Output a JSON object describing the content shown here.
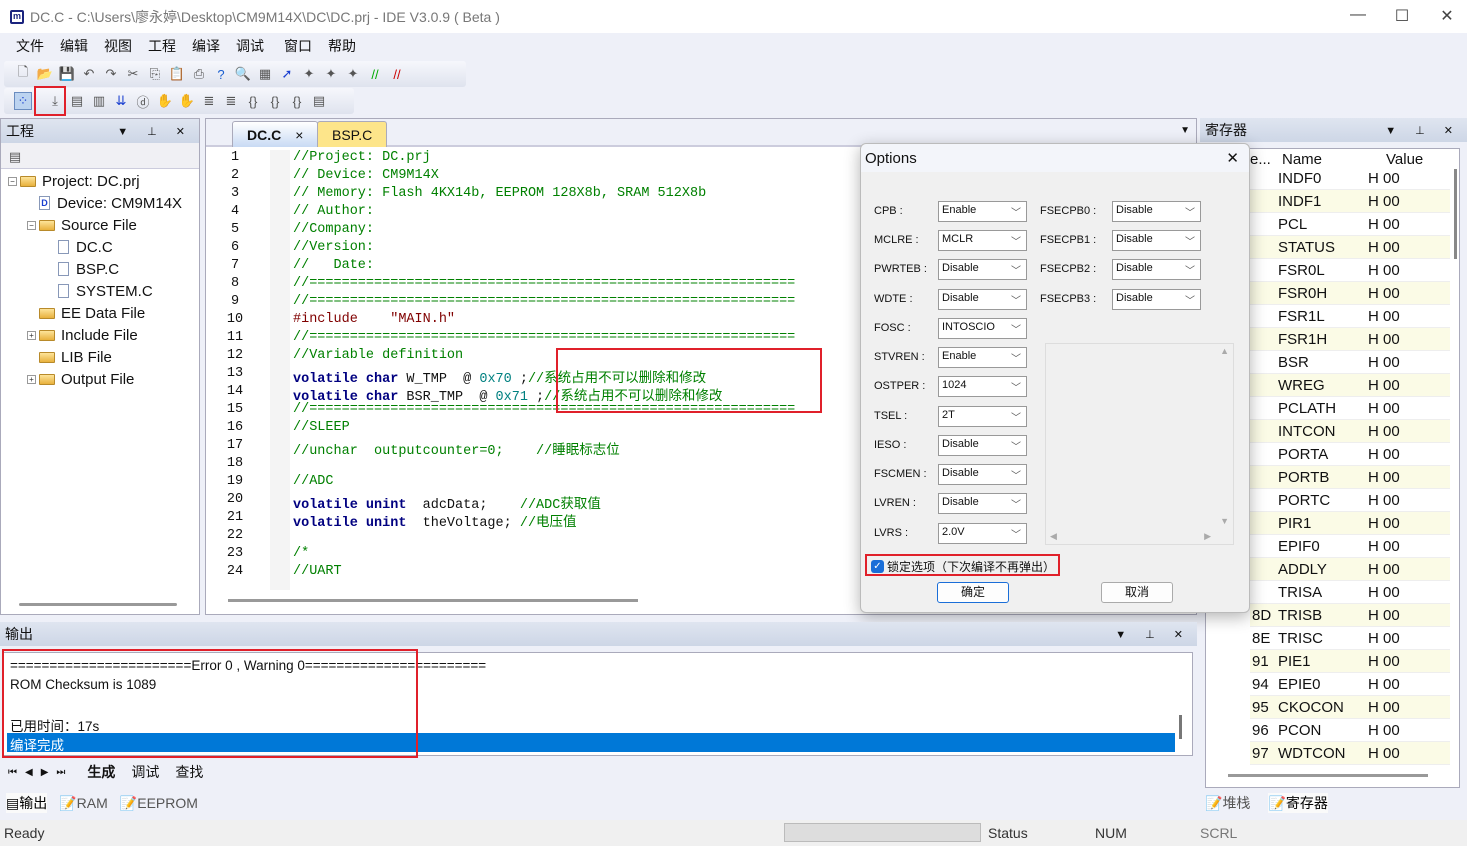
{
  "window": {
    "title": "DC.C - C:\\Users\\廖永婷\\Desktop\\CM9M14X\\DC\\DC.prj - IDE V3.0.9 ( Beta )",
    "min": "—",
    "max": "☐",
    "close": "✕"
  },
  "menu": [
    "文件",
    "编辑",
    "视图",
    "工程",
    "编译",
    "调试",
    "窗口",
    "帮助"
  ],
  "project_panel": {
    "title": "工程",
    "tree": [
      {
        "label": "Project:  DC.prj",
        "type": "folder",
        "level": 0,
        "expander": "−"
      },
      {
        "label": "Device:  CM9M14X",
        "type": "device",
        "level": 1,
        "expander": ""
      },
      {
        "label": "Source File",
        "type": "folder",
        "level": 1,
        "expander": "−"
      },
      {
        "label": "DC.C",
        "type": "file",
        "level": 2,
        "expander": ""
      },
      {
        "label": "BSP.C",
        "type": "file",
        "level": 2,
        "expander": ""
      },
      {
        "label": "SYSTEM.C",
        "type": "file",
        "level": 2,
        "expander": ""
      },
      {
        "label": "EE Data File",
        "type": "folder",
        "level": 1,
        "expander": ""
      },
      {
        "label": "Include File",
        "type": "folder",
        "level": 1,
        "expander": "+"
      },
      {
        "label": "LIB File",
        "type": "folder",
        "level": 1,
        "expander": ""
      },
      {
        "label": "Output File",
        "type": "folder",
        "level": 1,
        "expander": "+"
      }
    ]
  },
  "editor": {
    "tabs": [
      {
        "label": "DC.C",
        "active": true,
        "close": "×"
      },
      {
        "label": "BSP.C",
        "active": false
      }
    ],
    "lines": [
      [
        [
          "c-com",
          "//Project: DC.prj"
        ]
      ],
      [
        [
          "c-com",
          "// Device: CM9M14X"
        ]
      ],
      [
        [
          "c-com",
          "// Memory: Flash 4KX14b, EEPROM 128X8b, SRAM 512X8b"
        ]
      ],
      [
        [
          "c-com",
          "// Author:"
        ]
      ],
      [
        [
          "c-com",
          "//Company:"
        ]
      ],
      [
        [
          "c-com",
          "//Version:"
        ]
      ],
      [
        [
          "c-com",
          "//   Date:"
        ]
      ],
      [
        [
          "c-com",
          "//============================================================"
        ]
      ],
      [
        [
          "c-com",
          "//============================================================"
        ]
      ],
      [
        [
          "c-pp",
          "#include    \"MAIN.h\""
        ]
      ],
      [
        [
          "c-com",
          "//============================================================"
        ]
      ],
      [
        [
          "c-com",
          "//Variable definition"
        ]
      ],
      [
        [
          "c-kw",
          "volatile char "
        ],
        [
          "c-txt",
          "W_TMP  @ "
        ],
        [
          "c-num",
          "0x70"
        ],
        [
          "c-txt",
          " ;"
        ],
        [
          "c-com",
          "//系统占用不可以删除和修改"
        ]
      ],
      [
        [
          "c-kw",
          "volatile char "
        ],
        [
          "c-txt",
          "BSR_TMP  @ "
        ],
        [
          "c-num",
          "0x71"
        ],
        [
          "c-txt",
          " ;"
        ],
        [
          "c-com",
          "//系统占用不可以删除和修改"
        ]
      ],
      [
        [
          "c-com",
          "//============================================================"
        ]
      ],
      [
        [
          "c-com",
          "//SLEEP"
        ]
      ],
      [
        [
          "c-com",
          "//unchar  outputcounter=0;    //睡眠标志位"
        ]
      ],
      [
        [
          "c-txt",
          ""
        ]
      ],
      [
        [
          "c-com",
          "//ADC"
        ]
      ],
      [
        [
          "c-kw",
          "volatile unint  "
        ],
        [
          "c-txt",
          "adcData;    "
        ],
        [
          "c-com",
          "//ADC获取值"
        ]
      ],
      [
        [
          "c-kw",
          "volatile unint  "
        ],
        [
          "c-txt",
          "theVoltage; "
        ],
        [
          "c-com",
          "//电压值"
        ]
      ],
      [
        [
          "c-txt",
          ""
        ]
      ],
      [
        [
          "c-com",
          "/*"
        ]
      ],
      [
        [
          "c-com",
          "//UART"
        ]
      ]
    ]
  },
  "options_dialog": {
    "title": "Options",
    "close": "✕",
    "left": [
      {
        "label": "CPB :",
        "value": "Enable"
      },
      {
        "label": "MCLRE :",
        "value": "MCLR"
      },
      {
        "label": "PWRTEB :",
        "value": "Disable"
      },
      {
        "label": "WDTE :",
        "value": "Disable"
      },
      {
        "label": "FOSC :",
        "value": "INTOSCIO"
      },
      {
        "label": "STVREN :",
        "value": "Enable"
      },
      {
        "label": "OSTPER :",
        "value": "1024"
      },
      {
        "label": "TSEL :",
        "value": "2T"
      },
      {
        "label": "IESO :",
        "value": "Disable"
      },
      {
        "label": "FSCMEN :",
        "value": "Disable"
      },
      {
        "label": "LVREN :",
        "value": "Disable"
      },
      {
        "label": "LVRS :",
        "value": "2.0V"
      }
    ],
    "right": [
      {
        "label": "FSECPB0 :",
        "value": "Disable"
      },
      {
        "label": "FSECPB1 :",
        "value": "Disable"
      },
      {
        "label": "FSECPB2 :",
        "value": "Disable"
      },
      {
        "label": "FSECPB3 :",
        "value": "Disable"
      }
    ],
    "lock_checkbox": {
      "label": "锁定选项（下次编译不再弹出）",
      "checked": true
    },
    "ok": "确定",
    "cancel": "取消"
  },
  "register_panel": {
    "title": "寄存器",
    "columns": [
      "e...",
      "Name",
      "Value"
    ],
    "rows": [
      {
        "addr": "",
        "name": "INDF0",
        "value": "H 00"
      },
      {
        "addr": "",
        "name": "INDF1",
        "value": "H 00"
      },
      {
        "addr": "",
        "name": "PCL",
        "value": "H 00"
      },
      {
        "addr": "",
        "name": "STATUS",
        "value": "H 00"
      },
      {
        "addr": "",
        "name": "FSR0L",
        "value": "H 00"
      },
      {
        "addr": "",
        "name": "FSR0H",
        "value": "H 00"
      },
      {
        "addr": "",
        "name": "FSR1L",
        "value": "H 00"
      },
      {
        "addr": "",
        "name": "FSR1H",
        "value": "H 00"
      },
      {
        "addr": "",
        "name": "BSR",
        "value": "H 00"
      },
      {
        "addr": "",
        "name": "WREG",
        "value": "H 00"
      },
      {
        "addr": "",
        "name": "PCLATH",
        "value": "H 00"
      },
      {
        "addr": "",
        "name": "INTCON",
        "value": "H 00"
      },
      {
        "addr": "",
        "name": "PORTA",
        "value": "H 00"
      },
      {
        "addr": "",
        "name": "PORTB",
        "value": "H 00"
      },
      {
        "addr": "",
        "name": "PORTC",
        "value": "H 00"
      },
      {
        "addr": "",
        "name": "PIR1",
        "value": "H 00"
      },
      {
        "addr": "",
        "name": "EPIF0",
        "value": "H 00"
      },
      {
        "addr": "",
        "name": "ADDLY",
        "value": "H 00"
      },
      {
        "addr": "",
        "name": "TRISA",
        "value": "H 00"
      },
      {
        "addr": "8D",
        "name": "TRISB",
        "value": "H 00"
      },
      {
        "addr": "8E",
        "name": "TRISC",
        "value": "H 00"
      },
      {
        "addr": "91",
        "name": "PIE1",
        "value": "H 00"
      },
      {
        "addr": "94",
        "name": "EPIE0",
        "value": "H 00"
      },
      {
        "addr": "95",
        "name": "CKOCON",
        "value": "H 00"
      },
      {
        "addr": "96",
        "name": "PCON",
        "value": "H 00"
      },
      {
        "addr": "97",
        "name": "WDTCON",
        "value": "H 00"
      }
    ],
    "bottom_tabs": [
      "堆栈",
      "寄存器"
    ]
  },
  "output_panel": {
    "title": "输出",
    "lines": [
      "=======================Error 0 , Warning 0=======================",
      "ROM Checksum is 1089",
      "",
      "已用时间：17s",
      "编译完成"
    ],
    "tabs": [
      "生成",
      "调试",
      "查找"
    ],
    "nav": [
      "⏮",
      "◀",
      "▶",
      "⏭"
    ],
    "bottom_tabs": [
      "输出",
      "RAM",
      "EEPROM"
    ]
  },
  "statusbar": {
    "ready": "Ready",
    "status": "Status",
    "num": "NUM",
    "scrl": "SCRL"
  },
  "colors": {
    "highlight": "#0078d7",
    "annotation_box": "#e0202a"
  }
}
